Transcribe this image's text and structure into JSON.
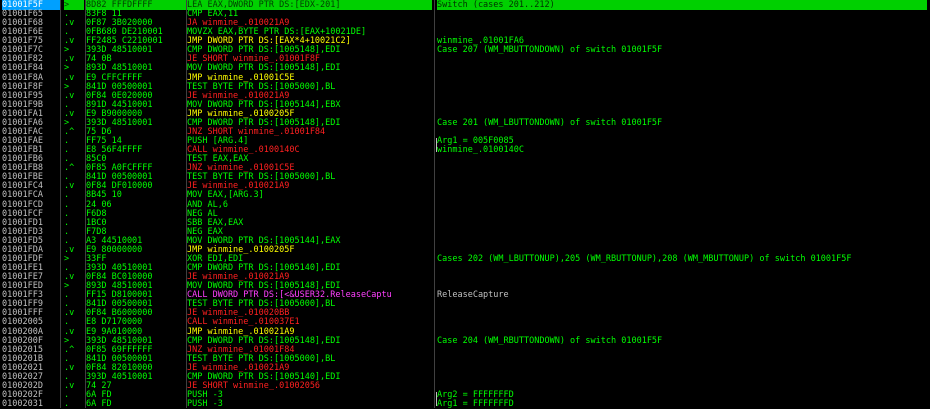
{
  "rows": [
    {
      "addr": "01001F5F",
      "mark": ">",
      "hex": "8D82 FFFDFFFF",
      "dis": "LEA EAX,DWORD PTR DS:[EDX-201]",
      "cmt": "Switch (cases 201..212)",
      "dc": "g",
      "sel": true
    },
    {
      "addr": "01001F65",
      "mark": ".",
      "hex": "83F8 11",
      "dis": "CMP EAX,11",
      "cmt": "",
      "dc": "g"
    },
    {
      "addr": "01001F68",
      "mark": ".v",
      "hex": "0F87 3B020000",
      "dis": "JA winmine_.010021A9",
      "cmt": "",
      "dc": "r"
    },
    {
      "addr": "01001F6E",
      "mark": ".",
      "hex": "0FB680 DE210001",
      "dis": "MOVZX EAX,BYTE PTR DS:[EAX+10021DE]",
      "cmt": "",
      "dc": "g"
    },
    {
      "addr": "01001F75",
      "mark": ".v",
      "hex": "FF2485 C2210001",
      "dis": "JMP DWORD PTR DS:[EAX*4+10021C2]",
      "cmt": "winmine_.01001FA6",
      "dc": "y"
    },
    {
      "addr": "01001F7C",
      "mark": ">",
      "hex": "393D 48510001",
      "dis": "CMP DWORD PTR DS:[1005148],EDI",
      "cmt": "Case 207 (WM_MBUTTONDOWN) of switch 01001F5F",
      "dc": "g"
    },
    {
      "addr": "01001F82",
      "mark": ".v",
      "hex": "74 0B",
      "dis": "JE SHORT winmine_.01001F8F",
      "cmt": "",
      "dc": "r"
    },
    {
      "addr": "01001F84",
      "mark": ">",
      "hex": "893D 48510001",
      "dis": "MOV DWORD PTR DS:[1005148],EDI",
      "cmt": "",
      "dc": "g"
    },
    {
      "addr": "01001F8A",
      "mark": ".v",
      "hex": "E9 CFFCFFFF",
      "dis": "JMP winmine_.01001C5E",
      "cmt": "",
      "dc": "y"
    },
    {
      "addr": "01001F8F",
      "mark": ">",
      "hex": "841D 00500001",
      "dis": "TEST BYTE PTR DS:[1005000],BL",
      "cmt": "",
      "dc": "g"
    },
    {
      "addr": "01001F95",
      "mark": ".v",
      "hex": "0F84 0E020000",
      "dis": "JE winmine_.010021A9",
      "cmt": "",
      "dc": "r"
    },
    {
      "addr": "01001F9B",
      "mark": ".",
      "hex": "891D 44510001",
      "dis": "MOV DWORD PTR DS:[1005144],EBX",
      "cmt": "",
      "dc": "g"
    },
    {
      "addr": "01001FA1",
      "mark": ".v",
      "hex": "E9 B9000000",
      "dis": "JMP winmine_.0100205F",
      "cmt": "",
      "dc": "y"
    },
    {
      "addr": "01001FA6",
      "mark": ">",
      "hex": "393D 48510001",
      "dis": "CMP DWORD PTR DS:[1005148],EDI",
      "cmt": "Case 201 (WM_LBUTTONDOWN) of switch 01001F5F",
      "dc": "g"
    },
    {
      "addr": "01001FAC",
      "mark": ".^",
      "hex": "75 D6",
      "dis": "JNZ SHORT winmine_.01001F84",
      "cmt": "",
      "dc": "r"
    },
    {
      "addr": "01001FAE",
      "mark": ".",
      "hex": "FF75 14",
      "dis": "PUSH [ARG.4]",
      "cmt": "Arg1 = 005F0085",
      "dc": "g"
    },
    {
      "addr": "01001FB1",
      "mark": ".",
      "hex": "E8 56F4FFFF",
      "dis": "CALL winmine_.0100140C",
      "cmt": "winmine_.0100140C",
      "dc": "r"
    },
    {
      "addr": "01001FB6",
      "mark": ".",
      "hex": "85C0",
      "dis": "TEST EAX,EAX",
      "cmt": "",
      "dc": "g"
    },
    {
      "addr": "01001FB8",
      "mark": ".^",
      "hex": "0F85 A0FCFFFF",
      "dis": "JNZ winmine_.01001C5E",
      "cmt": "",
      "dc": "r"
    },
    {
      "addr": "01001FBE",
      "mark": ".",
      "hex": "841D 00500001",
      "dis": "TEST BYTE PTR DS:[1005000],BL",
      "cmt": "",
      "dc": "g"
    },
    {
      "addr": "01001FC4",
      "mark": ".v",
      "hex": "0F84 DF010000",
      "dis": "JE winmine_.010021A9",
      "cmt": "",
      "dc": "r"
    },
    {
      "addr": "01001FCA",
      "mark": ".",
      "hex": "8B45 10",
      "dis": "MOV EAX,[ARG.3]",
      "cmt": "",
      "dc": "g"
    },
    {
      "addr": "01001FCD",
      "mark": ".",
      "hex": "24 06",
      "dis": "AND AL,6",
      "cmt": "",
      "dc": "g"
    },
    {
      "addr": "01001FCF",
      "mark": ".",
      "hex": "F6D8",
      "dis": "NEG AL",
      "cmt": "",
      "dc": "g"
    },
    {
      "addr": "01001FD1",
      "mark": ".",
      "hex": "1BC0",
      "dis": "SBB EAX,EAX",
      "cmt": "",
      "dc": "g"
    },
    {
      "addr": "01001FD3",
      "mark": ".",
      "hex": "F7D8",
      "dis": "NEG EAX",
      "cmt": "",
      "dc": "g"
    },
    {
      "addr": "01001FD5",
      "mark": ".",
      "hex": "A3 44510001",
      "dis": "MOV DWORD PTR DS:[1005144],EAX",
      "cmt": "",
      "dc": "g"
    },
    {
      "addr": "01001FDA",
      "mark": ".v",
      "hex": "E9 80000000",
      "dis": "JMP winmine_.0100205F",
      "cmt": "",
      "dc": "y"
    },
    {
      "addr": "01001FDF",
      "mark": ">",
      "hex": "33FF",
      "dis": "XOR EDI,EDI",
      "cmt": "Cases 202 (WM_LBUTTONUP),205 (WM_RBUTTONUP),208 (WM_MBUTTONUP) of switch 01001F5F",
      "dc": "g"
    },
    {
      "addr": "01001FE1",
      "mark": ".",
      "hex": "393D 40510001",
      "dis": "CMP DWORD PTR DS:[1005140],EDI",
      "cmt": "",
      "dc": "g"
    },
    {
      "addr": "01001FE7",
      "mark": ".v",
      "hex": "0F84 BC010000",
      "dis": "JE winmine_.010021A9",
      "cmt": "",
      "dc": "r"
    },
    {
      "addr": "01001FED",
      "mark": ">",
      "hex": "893D 48510001",
      "dis": "MOV DWORD PTR DS:[1005148],EDI",
      "cmt": "",
      "dc": "g"
    },
    {
      "addr": "01001FF3",
      "mark": ".",
      "hex": "FF15 D8100001",
      "dis": "CALL DWORD PTR DS:[<&USER32.ReleaseCaptu",
      "cmt": "ReleaseCapture",
      "dc": "m",
      "cc": "c"
    },
    {
      "addr": "01001FF9",
      "mark": ".",
      "hex": "841D 00500001",
      "dis": "TEST BYTE PTR DS:[1005000],BL",
      "cmt": "",
      "dc": "g"
    },
    {
      "addr": "01001FFF",
      "mark": ".v",
      "hex": "0F84 B6000000",
      "dis": "JE winmine_.010020BB",
      "cmt": "",
      "dc": "r"
    },
    {
      "addr": "01002005",
      "mark": ".",
      "hex": "E8 D7170000",
      "dis": "CALL winmine_.010037E1",
      "cmt": "",
      "dc": "r"
    },
    {
      "addr": "0100200A",
      "mark": ".v",
      "hex": "E9 9A010000",
      "dis": "JMP winmine_.010021A9",
      "cmt": "",
      "dc": "y"
    },
    {
      "addr": "0100200F",
      "mark": ">",
      "hex": "393D 48510001",
      "dis": "CMP DWORD PTR DS:[1005148],EDI",
      "cmt": "Case 204 (WM_RBUTTONDOWN) of switch 01001F5F",
      "dc": "g"
    },
    {
      "addr": "01002015",
      "mark": ".^",
      "hex": "0F85 69FFFFFF",
      "dis": "JNZ winmine_.01001F84",
      "cmt": "",
      "dc": "r"
    },
    {
      "addr": "0100201B",
      "mark": ".",
      "hex": "841D 00500001",
      "dis": "TEST BYTE PTR DS:[1005000],BL",
      "cmt": "",
      "dc": "g"
    },
    {
      "addr": "01002021",
      "mark": ".v",
      "hex": "0F84 82010000",
      "dis": "JE winmine_.010021A9",
      "cmt": "",
      "dc": "r"
    },
    {
      "addr": "01002027",
      "mark": ".",
      "hex": "393D 40510001",
      "dis": "CMP DWORD PTR DS:[1005140],EDI",
      "cmt": "",
      "dc": "g"
    },
    {
      "addr": "0100202D",
      "mark": ".v",
      "hex": "74 27",
      "dis": "JE SHORT winmine_.01002056",
      "cmt": "",
      "dc": "r"
    },
    {
      "addr": "0100202F",
      "mark": ".",
      "hex": "6A FD",
      "dis": "PUSH -3",
      "cmt": "Arg2 = FFFFFFFD",
      "dc": "g"
    },
    {
      "addr": "01002031",
      "mark": ".",
      "hex": "6A FD",
      "dis": "PUSH -3",
      "cmt": "Arg1 = FFFFFFFD",
      "dc": "g"
    }
  ],
  "colors": {
    "accent_selected": "#00d000",
    "address_highlight": "#00a0ff"
  }
}
